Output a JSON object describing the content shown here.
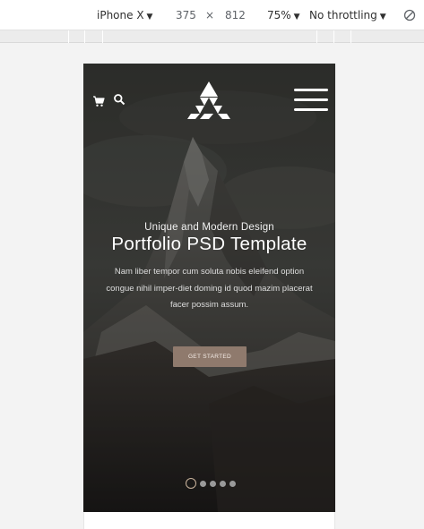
{
  "devtools": {
    "device_name": "iPhone X",
    "width": "375",
    "times": "×",
    "height": "812",
    "zoom": "75%",
    "throttling": "No throttling",
    "caret": "▼"
  },
  "hero": {
    "subtitle": "Unique and Modern Design",
    "title": "Portfolio PSD Template",
    "description": "Nam liber tempor cum soluta nobis eleifend option congue nihil imper-diet doming id quod mazim placerat facer possim assum.",
    "cta_label": "GET STARTED"
  },
  "slider": {
    "count": 5,
    "active_index": 0
  },
  "icons": {
    "cart": "cart-icon",
    "search": "search-icon",
    "logo": "triangle-logo",
    "menu": "hamburger-menu-icon",
    "rotate": "rotate-icon"
  },
  "colors": {
    "accent": "#8f7a6d",
    "active_dot": "#c9b39c"
  }
}
